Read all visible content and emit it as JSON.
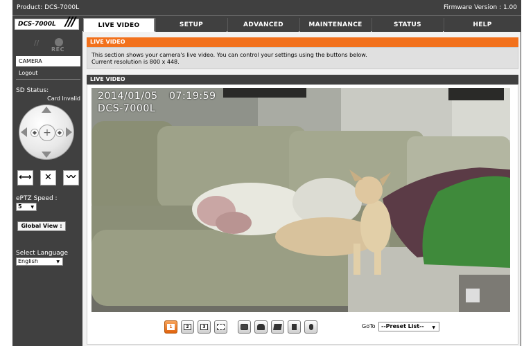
{
  "header": {
    "product": "Product: DCS-7000L",
    "firmware": "Firmware Version : 1.00",
    "model_logo": "DCS-7000L"
  },
  "tabs": [
    {
      "label": "LIVE VIDEO",
      "active": true
    },
    {
      "label": "SETUP",
      "active": false
    },
    {
      "label": "ADVANCED",
      "active": false
    },
    {
      "label": "MAINTENANCE",
      "active": false
    },
    {
      "label": "STATUS",
      "active": false
    },
    {
      "label": "HELP",
      "active": false
    }
  ],
  "sidebar": {
    "rec_label": "REC",
    "camera_label": "CAMERA",
    "logout_label": "Logout",
    "sd_status_label": "SD Status:",
    "sd_status_value": "Card Invalid",
    "eptz_speed_label": "ePTZ Speed :",
    "eptz_speed_value": "5",
    "global_view_label": "Global View :",
    "language_label": "Select Language",
    "language_value": "English"
  },
  "main": {
    "section_title": "LIVE VIDEO",
    "description_line1": "This section shows your camera's live video. You can control your settings using the buttons below.",
    "description_line2": "Current resolution is 800 x 448.",
    "video_title": "LIVE VIDEO",
    "osd_date": "2014/01/05",
    "osd_time": "07:19:59",
    "osd_name": "DCS-7000L"
  },
  "controls": {
    "buttons": [
      {
        "name": "profile-1-button",
        "glyph": "1",
        "active": true
      },
      {
        "name": "profile-2-button",
        "glyph": "2",
        "active": false
      },
      {
        "name": "profile-3-button",
        "glyph": "3",
        "active": false
      },
      {
        "name": "fullscreen-button",
        "glyph": "",
        "active": false
      },
      {
        "name": "snapshot-button",
        "glyph": "",
        "active": false
      },
      {
        "name": "record-button",
        "glyph": "",
        "active": false
      },
      {
        "name": "folder-button",
        "glyph": "",
        "active": false
      },
      {
        "name": "speaker-button",
        "glyph": "",
        "active": false
      },
      {
        "name": "microphone-button",
        "glyph": "",
        "active": false
      }
    ],
    "goto_label": "GoTo",
    "preset_value": "--Preset List--"
  },
  "colors": {
    "accent_orange": "#f2711c",
    "dark_bar": "#404040"
  }
}
